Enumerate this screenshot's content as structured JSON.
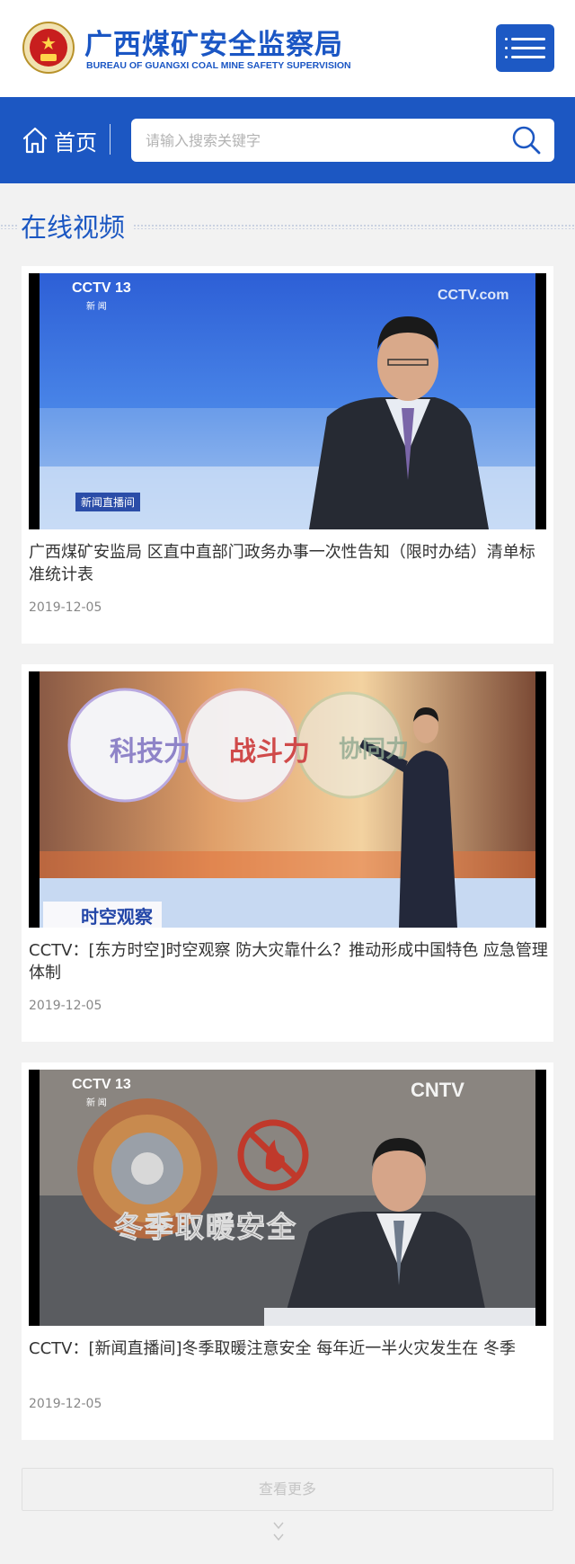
{
  "header": {
    "title": "广西煤矿安全监察局",
    "subtitle": "BUREAU OF GUANGXI COAL MINE SAFETY SUPERVISION",
    "logo_icon": "national-emblem-icon",
    "menu_icon": "menu-icon"
  },
  "nav": {
    "home_label": "首页",
    "home_icon": "home-icon",
    "search_placeholder": "请输入搜索关键字",
    "search_icon": "search-icon"
  },
  "section": {
    "title": "在线视频"
  },
  "videos": [
    {
      "title": "广西煤矿安监局 区直中直部门政务办事一次性告知（限时办结）清单标准统计表",
      "date": "2019-12-05",
      "thumb": {
        "channel_logo": "CCTV 13",
        "channel_sub": "新 闻",
        "watermark": "CCTV.com",
        "program_tag": "新闻直播间"
      }
    },
    {
      "title": "CCTV：[东方时空]时空观察 防大灾靠什么？推动形成中国特色 应急管理体制",
      "date": "2019-12-05",
      "thumb": {
        "circle_labels": [
          "科技力",
          "战斗力",
          "协同力"
        ],
        "program_tag": "时空观察"
      }
    },
    {
      "title": "CCTV：[新闻直播间]冬季取暖注意安全 每年近一半火灾发生在 冬季",
      "date": "2019-12-05",
      "thumb": {
        "channel_logo": "CCTV 13",
        "channel_sub": "新 闻",
        "watermark": "CNTV",
        "headline": "冬季取暖安全"
      }
    }
  ],
  "more": {
    "label": "查看更多",
    "icon": "double-chevron-down-icon"
  },
  "colors": {
    "brand_blue": "#1c57c2",
    "page_bg": "#f2f2f2"
  }
}
